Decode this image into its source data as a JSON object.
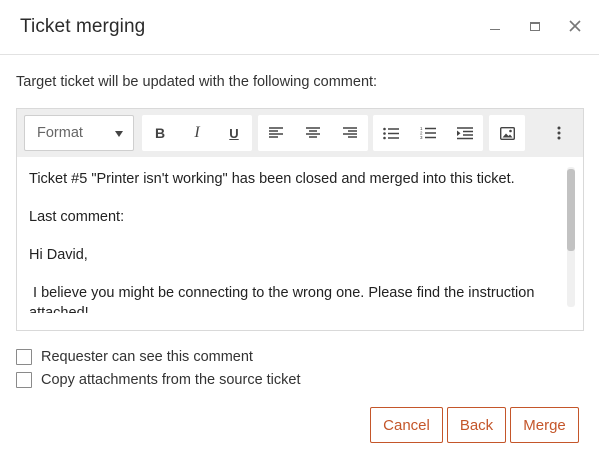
{
  "window": {
    "title": "Ticket merging",
    "close_glyph": "✕"
  },
  "intro_text": "Target ticket will be updated with the following comment:",
  "editor": {
    "format_label": "Format",
    "bold_label": "B",
    "italic_label": "I",
    "underline_label": "U",
    "content": [
      "Ticket #5 \"Printer isn't working\" has been closed and merged into this ticket.",
      "Last comment:",
      "Hi David,",
      " I believe you might be connecting to the wrong one. Please find the instruction",
      "attached!"
    ]
  },
  "options": {
    "requester_label": "Requester can see this comment",
    "requester_checked": false,
    "copy_attachments_label": "Copy attachments from the source ticket",
    "copy_attachments_checked": false
  },
  "footer": {
    "cancel_label": "Cancel",
    "back_label": "Back",
    "merge_label": "Merge"
  },
  "colors": {
    "accent": "#c4562a",
    "toolbar_bg": "#eeeeee"
  },
  "icons": [
    "minimize-icon",
    "maximize-icon",
    "close-icon",
    "align-left-icon",
    "align-center-icon",
    "align-right-icon",
    "bullet-list-icon",
    "numbered-list-icon",
    "indent-icon",
    "image-icon",
    "more-vertical-icon"
  ]
}
